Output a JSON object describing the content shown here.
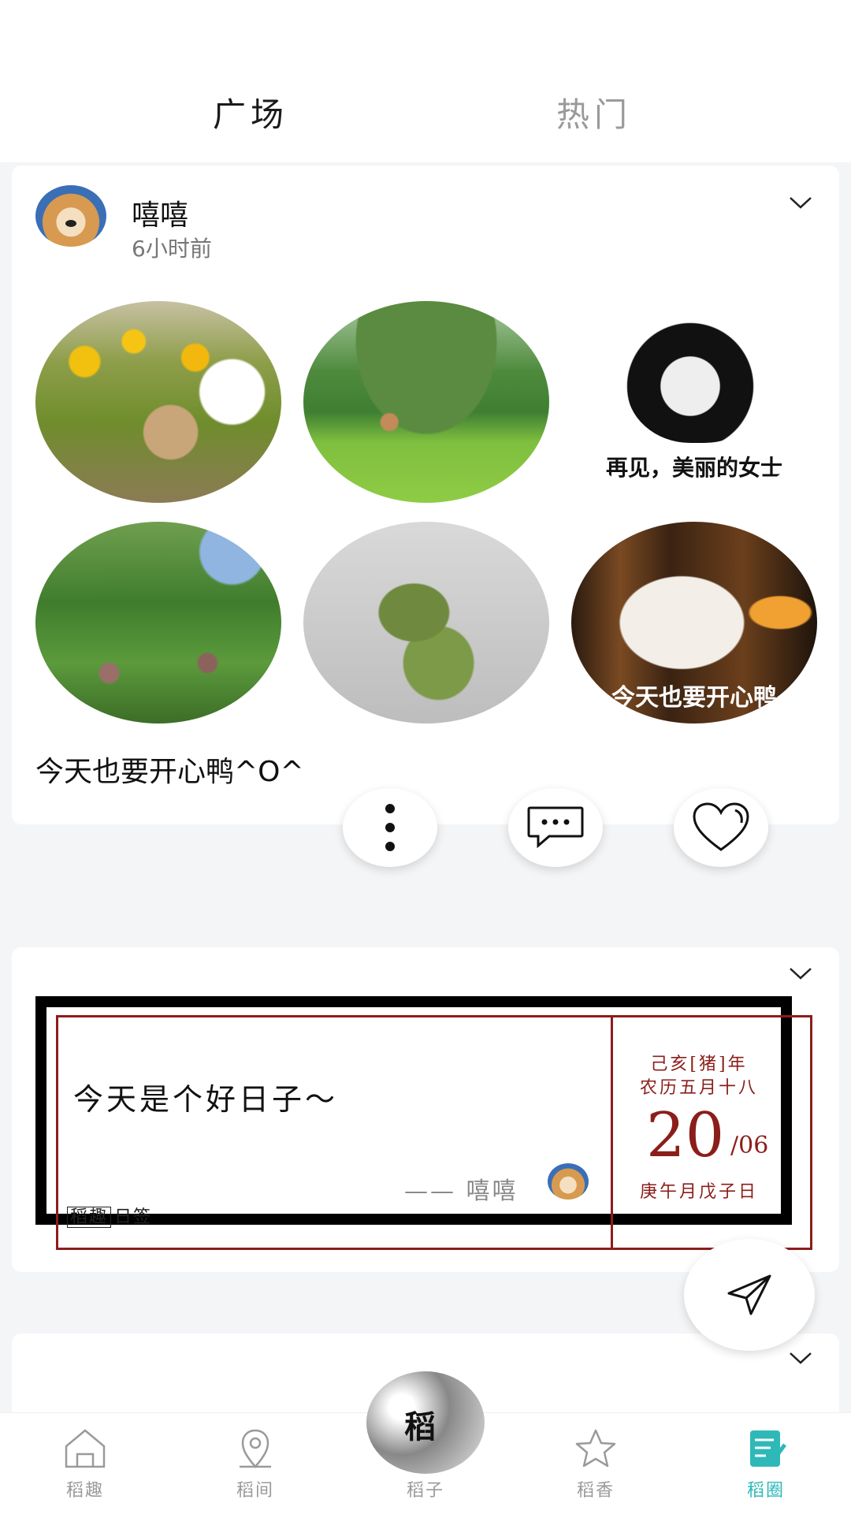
{
  "tabs": {
    "square": "广场",
    "hot": "热门"
  },
  "post": {
    "username": "嘻嘻",
    "time": "6小时前",
    "meme_caption": "再见，美丽的女士",
    "duck_caption": "今天也要开心鸭",
    "text": "今天也要开心鸭^O^"
  },
  "sign_card": {
    "quote": "今天是个好日子～",
    "author": "—— 嘻嘻",
    "brand_logo": "稻趣",
    "brand_label": "日签",
    "lunar_year": "己亥[猪]年",
    "lunar_date": "农历五月十八",
    "day": "20",
    "month": "/06",
    "ganzhi": "庚午月戊子日",
    "accent_color": "#8b1e1a"
  },
  "nav": {
    "items": [
      {
        "label": "稻趣",
        "icon": "home-icon"
      },
      {
        "label": "稻间",
        "icon": "location-icon"
      },
      {
        "label": "稻子",
        "icon": "rice-logo-icon"
      },
      {
        "label": "稻香",
        "icon": "star-icon"
      },
      {
        "label": "稻圈",
        "icon": "notes-icon"
      }
    ],
    "center_logo": "稻",
    "active_color": "#2fb8b8"
  }
}
